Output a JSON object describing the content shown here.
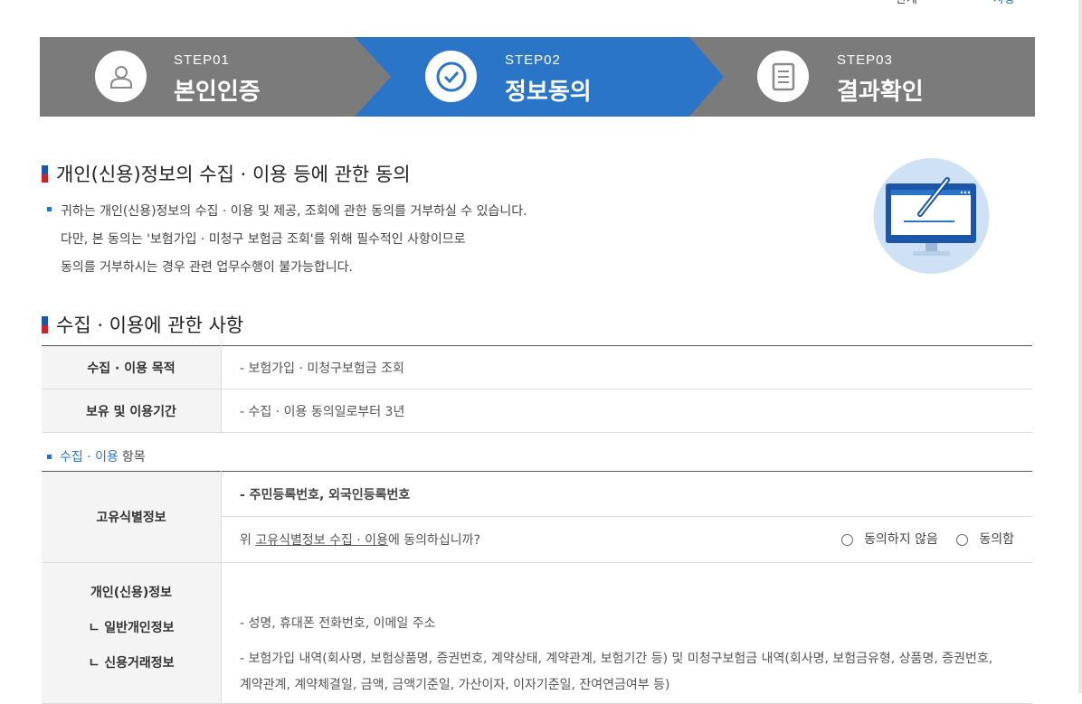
{
  "top_fragments": {
    "left": "관계",
    "right": "사항"
  },
  "steps": [
    {
      "num": "STEP01",
      "title": "본인인증",
      "icon": "user-icon",
      "active": false
    },
    {
      "num": "STEP02",
      "title": "정보동의",
      "icon": "check-icon",
      "active": true
    },
    {
      "num": "STEP03",
      "title": "결과확인",
      "icon": "document-icon",
      "active": false
    }
  ],
  "consent_section": {
    "heading": "개인(신용)정보의 수집 · 이용 등에 관한 동의",
    "lines": [
      "귀하는 개인(신용)정보의 수집 · 이용 및 제공, 조회에 관한 동의를 거부하실 수 있습니다.",
      "다만, 본 동의는 '보험가입 · 미청구 보험금 조회'를 위해 필수적인 사항이므로",
      "동의를 거부하시는 경우 관련 업무수행이 불가능합니다."
    ]
  },
  "usage_section": {
    "heading": "수집 · 이용에 관한 사항",
    "rows": [
      {
        "label": "수집 · 이용 목적",
        "value": "- 보험가입 · 미청구보험금 조회"
      },
      {
        "label": "보유 및 이용기간",
        "value": "- 수집 · 이용 동의일로부터 3년"
      }
    ]
  },
  "items_label": {
    "blue": "수집 · 이용",
    "dark": "항목"
  },
  "unique_id": {
    "label": "고유식별정보",
    "value": "- 주민등록번호, 외국인등록번호",
    "question_prefix": "위 ",
    "question_link": "고유식별정보 수집 · 이용",
    "question_suffix": "에 동의하십니까?",
    "option_disagree": "동의하지 않음",
    "option_agree": "동의함"
  },
  "personal_info": {
    "label": "개인(신용)정보",
    "general_label": "ㄴ 일반개인정보",
    "general_value": "- 성명, 휴대폰 전화번호, 이메일 주소",
    "credit_label": "ㄴ 신용거래정보",
    "credit_value_1": "- 보험가입 내역(회사명, 보험상품명, 증권번호, 계약상태, 계약관계, 보험기간 등) 및 미청구보험금 내역(회사명, 보험금유형, 상품명, 증권번호,",
    "credit_value_2": "계약관계, 계약체결일, 금액, 금액기준일, 가산이자, 이자기준일, 잔여연금여부 등)"
  },
  "colors": {
    "active_step": "#2b75c9",
    "inactive_step": "#7b7b7b",
    "accent_red": "#c8252b",
    "accent_blue": "#1d56a8"
  }
}
